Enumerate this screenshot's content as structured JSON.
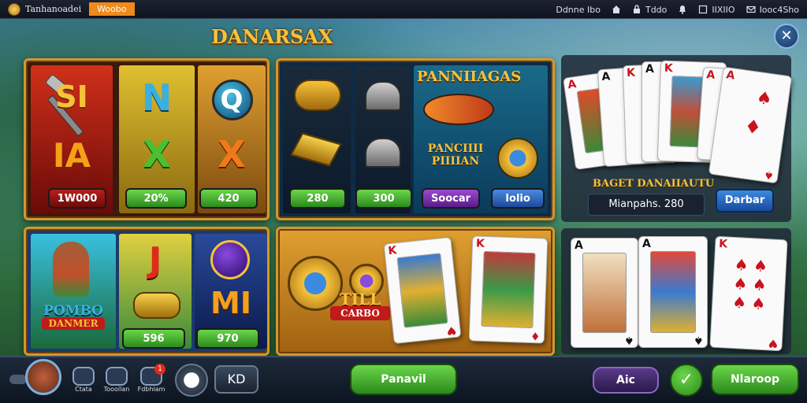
{
  "topbar": {
    "brand_name": "Tanhanoadei",
    "promo_label": "Woobo",
    "nav": [
      {
        "icon": "gift-icon",
        "label": "Ddnne Ibo"
      },
      {
        "icon": "home-icon",
        "label": ""
      },
      {
        "icon": "lock-icon",
        "label": "Tddo"
      },
      {
        "icon": "bell-icon",
        "label": ""
      },
      {
        "icon": "card-icon",
        "label": "IIXIIO"
      },
      {
        "icon": "mail-icon",
        "label": "Iooc4Sho"
      }
    ]
  },
  "title": "DANARSAX",
  "panel1": {
    "reels": [
      {
        "symbols": [
          "SI",
          "IA"
        ],
        "value": "1W000"
      },
      {
        "symbols": [
          "N",
          "X"
        ],
        "value": "20%"
      },
      {
        "symbols": [
          "Q",
          "X"
        ],
        "value": "420"
      }
    ]
  },
  "panel2": {
    "banner": "PANNIIAGAS",
    "sub_banner_line1": "PANCIIII",
    "sub_banner_line2": "PIIIIAN",
    "values": [
      "280",
      "300",
      "Soocar",
      "Iolio"
    ]
  },
  "panel3": {
    "label1": "BAGET DANAIIAUTU",
    "label2": "Mianpahs. 280",
    "button": "Darbar",
    "cards": [
      {
        "rank": "A",
        "suit": "♦",
        "color": "red"
      },
      {
        "rank": "A",
        "suit": "♠",
        "color": "black"
      },
      {
        "rank": "K",
        "suit": "♦",
        "color": "red"
      },
      {
        "rank": "A",
        "suit": "♠",
        "color": "black"
      },
      {
        "rank": "K",
        "suit": "♦",
        "color": "red"
      },
      {
        "rank": "A",
        "suit": "♦",
        "color": "red"
      },
      {
        "rank": "A",
        "suit": "♠",
        "color": "red"
      }
    ]
  },
  "panel4": {
    "banner_line1": "POMBO",
    "banner_line2": "DANMER",
    "symbols": [
      "J",
      "MI"
    ],
    "values": [
      "596",
      "970"
    ]
  },
  "panel5": {
    "coin_text_line1": "TILL",
    "coin_text_line2": "CARBO",
    "cards": [
      {
        "rank": "K",
        "suit": "♥",
        "color": "red"
      },
      {
        "rank": "K",
        "suit": "♦",
        "color": "red"
      }
    ]
  },
  "panel6": {
    "cards": [
      {
        "rank": "A",
        "suit": "♠",
        "color": "black"
      },
      {
        "rank": "A",
        "suit": "♠",
        "color": "black"
      },
      {
        "rank": "K",
        "suit": "♥",
        "color": "red"
      }
    ]
  },
  "bottombar": {
    "icons": [
      {
        "name": "chat-icon",
        "label": "Ctata"
      },
      {
        "name": "message-icon",
        "label": "Tooollan"
      },
      {
        "name": "friends-icon",
        "label": "Fdbhlam"
      }
    ],
    "notification_count": "1",
    "kd_label": "KD",
    "main_button": "Panavil",
    "secondary_button": "Aic",
    "confirm_icon": "check-icon",
    "play_button": "Nlaroop"
  },
  "colors": {
    "gold": "#f6c23a",
    "green": "#3db02a",
    "purple": "#6a3a9a",
    "blue": "#2a6ac8"
  }
}
